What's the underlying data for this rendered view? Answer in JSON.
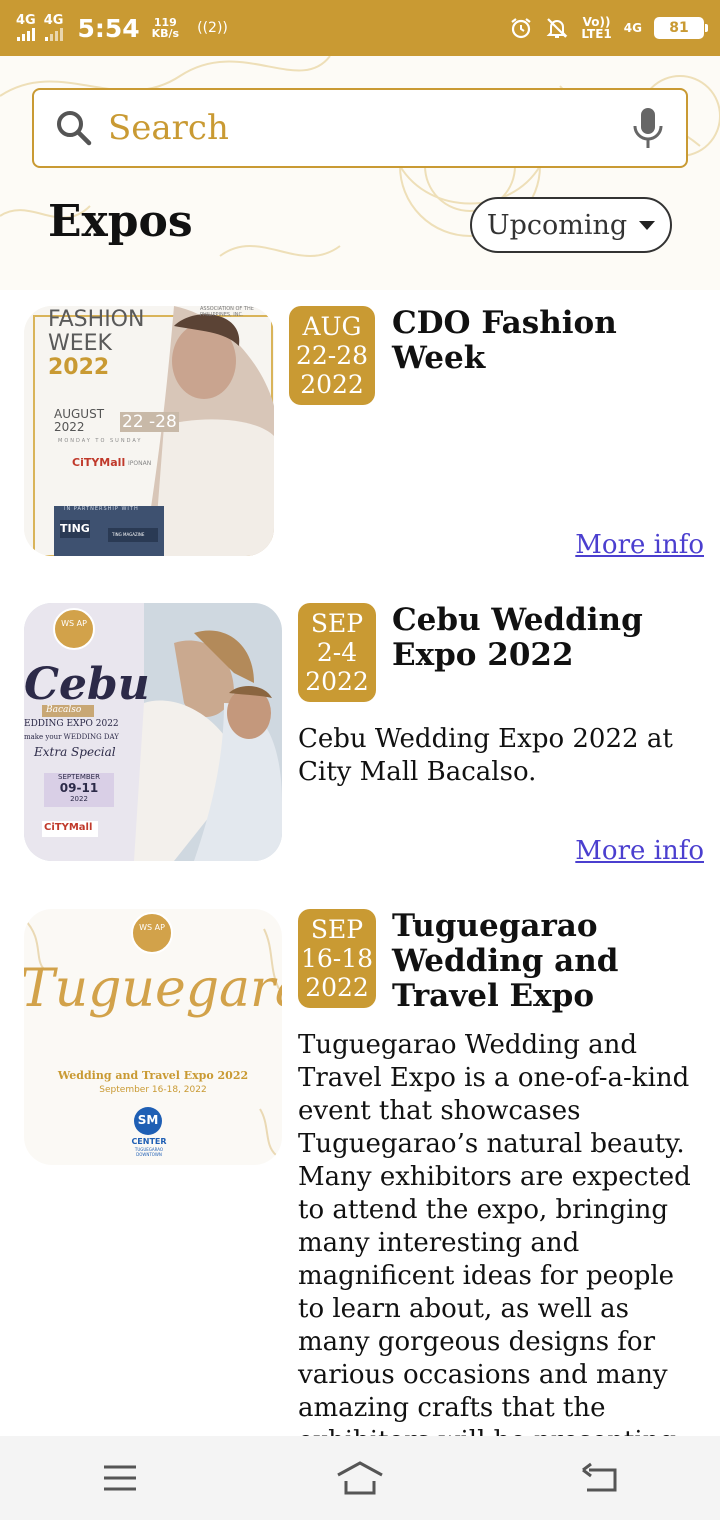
{
  "status_bar": {
    "network_1": "4G",
    "network_2": "4G",
    "time": "5:54",
    "speed_value": "119",
    "speed_unit": "KB/s",
    "hotspot": "((2))",
    "volte_1": "Vo))",
    "volte_2": "LTE1",
    "net_small": "4G",
    "battery": "81"
  },
  "search": {
    "placeholder": "Search",
    "value": ""
  },
  "page": {
    "title": "Expos",
    "filter_label": "Upcoming"
  },
  "expos": [
    {
      "month": "AUG",
      "days": "22-28",
      "year": "2022",
      "title": "CDO Fashion Week",
      "description": "",
      "more_info": "More info",
      "poster": {
        "line1": "FASHION",
        "line2": "WEEK",
        "year": "2022",
        "assoc": "ASSOCIATION OF THE PHILIPPINES, INC.",
        "month": "AUGUST",
        "year_small": "2022",
        "range": "22 -28",
        "weekday": "MONDAY TO SUNDAY",
        "mall": "CiTYMall",
        "mall_branch": "IPONAN",
        "partner": "IN PARTNERSHIP WITH",
        "partner_logo": "TING",
        "partner_2": "TING MAGAZINE"
      }
    },
    {
      "month": "SEP",
      "days": "2-4",
      "year": "2022",
      "title": "Cebu Wedding Expo 2022",
      "description": "Cebu Wedding Expo 2022 at City Mall Bacalso.",
      "more_info": "More info",
      "poster": {
        "badge": "WS AP",
        "city": "Cebu",
        "branch": "Bacalso",
        "event": "EDDING EXPO 2022",
        "tagline": "make your WEDDING DAY",
        "special": "Extra Special",
        "month": "SEPTEMBER",
        "range": "09-11",
        "year": "2022",
        "mall": "CiTYMall"
      }
    },
    {
      "month": "SEP",
      "days": "16-18",
      "year": "2022",
      "title": "Tuguegarao Wedding and Travel Expo",
      "description": "Tuguegarao Wedding and Travel Expo is a one-of-a-kind event that showcases Tuguegarao’s natural beauty. Many exhibitors are expected to attend the expo, bringing many interesting and magnificent ideas for people to learn about, as well as many gorgeous designs for various occasions and many amazing crafts that the exhibitors will be presenting. So, what",
      "more_info": "",
      "poster": {
        "badge": "WS AP",
        "script": "Tuguegarao",
        "event": "Wedding and Travel Expo 2022",
        "dates": "September 16-18, 2022",
        "mall": "SM",
        "mall_2": "CENTER",
        "mall_3": "TUGUEGARAO DOWNTOWN"
      }
    }
  ],
  "colors": {
    "accent": "#c99a33",
    "link": "#4b3fcf",
    "text": "#111111"
  },
  "nav": {
    "menu_icon": "menu-icon",
    "home_icon": "home-icon",
    "back_icon": "back-icon"
  }
}
